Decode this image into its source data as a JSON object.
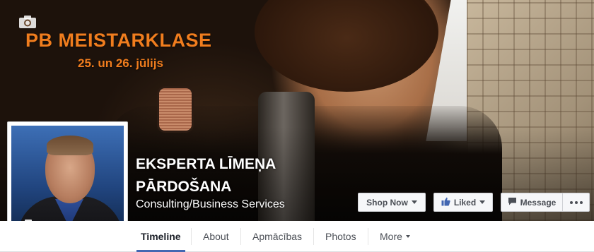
{
  "cover": {
    "promo_title": "PB MEISTARKLASE",
    "promo_date": "25. un 26. jūlijs"
  },
  "page": {
    "name": "EKSPERTA LĪMEŅA PĀRDOŠANA",
    "category": "Consulting/Business Services"
  },
  "actions": {
    "shop_now": "Shop Now",
    "liked": "Liked",
    "message": "Message"
  },
  "tabs": [
    {
      "label": "Timeline"
    },
    {
      "label": "About"
    },
    {
      "label": "Apmācības"
    },
    {
      "label": "Photos"
    },
    {
      "label": "More"
    }
  ],
  "colors": {
    "accent": "#4267b2",
    "promo_orange": "#f07d1e"
  },
  "icons": {
    "cover_camera": "camera-icon",
    "profile_camera": "camera-icon",
    "liked": "thumbs-up-icon",
    "message": "speech-bubble-icon",
    "more": "ellipsis-icon"
  }
}
